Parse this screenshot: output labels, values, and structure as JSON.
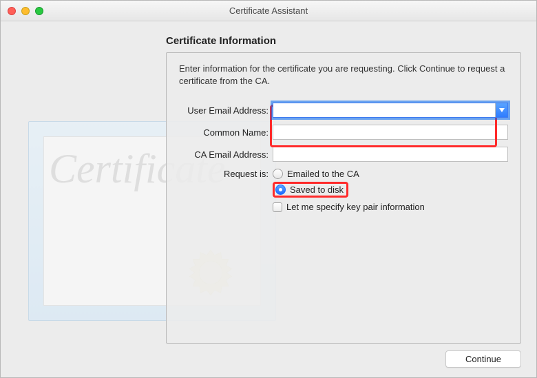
{
  "window": {
    "title": "Certificate Assistant"
  },
  "section": {
    "heading": "Certificate Information",
    "instructions": "Enter information for the certificate you are requesting. Click Continue to request a certificate from the CA."
  },
  "form": {
    "user_email_label": "User Email Address:",
    "user_email_value": "",
    "common_name_label": "Common Name:",
    "common_name_value": "",
    "ca_email_label": "CA Email Address:",
    "ca_email_value": "",
    "request_is_label": "Request is:",
    "option_emailed": "Emailed to the CA",
    "option_saved": "Saved to disk",
    "option_specify_keypair": "Let me specify key pair information",
    "selected_request": "saved"
  },
  "illustration": {
    "script_text": "Certificate"
  },
  "buttons": {
    "continue": "Continue"
  }
}
